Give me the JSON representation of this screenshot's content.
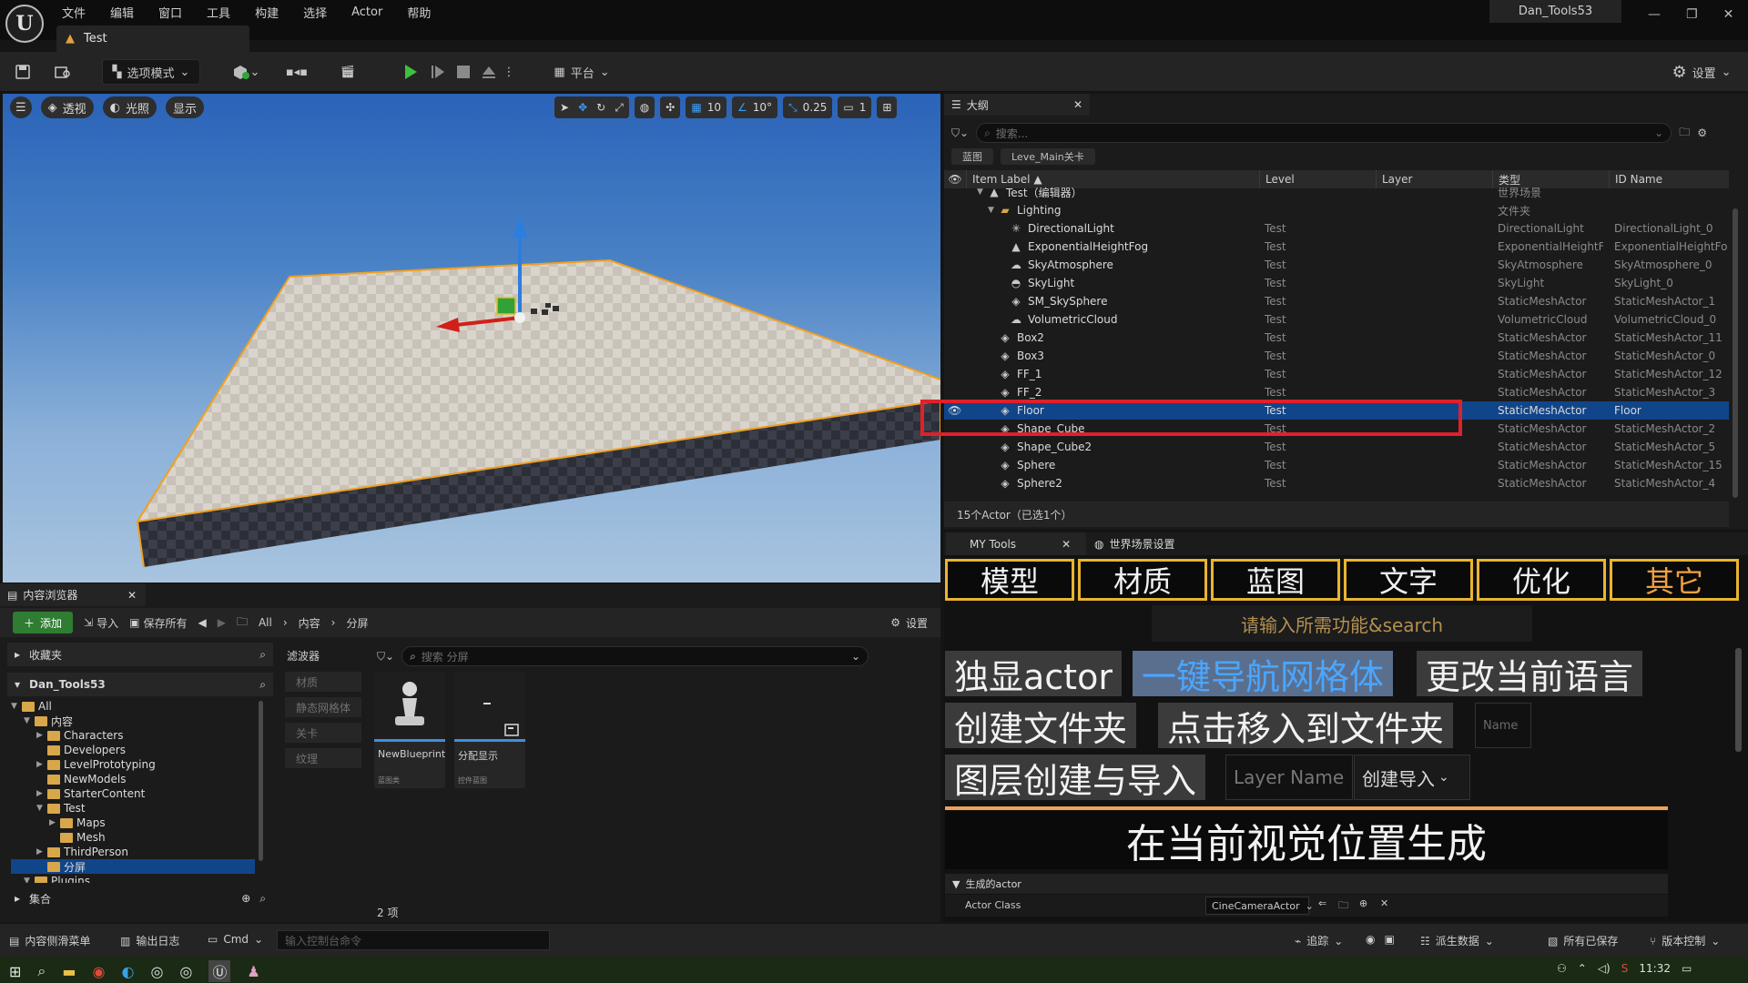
{
  "app": {
    "menu": [
      "文件",
      "编辑",
      "窗口",
      "工具",
      "构建",
      "选择",
      "Actor",
      "帮助"
    ],
    "project_name": "Dan_Tools53",
    "doc_tab": "Test",
    "window_controls": [
      "—",
      "❐",
      "✕"
    ]
  },
  "toolbar": {
    "mode_label": "选项模式",
    "platform_label": "平台",
    "settings_label": "设置"
  },
  "viewport": {
    "perspective": "透视",
    "lighting": "光照",
    "show": "显示",
    "grid_snap": "10",
    "rot_snap": "10°",
    "scale_snap": "0.25",
    "camera_speed": "1"
  },
  "outliner": {
    "tab_title": "大纲",
    "search_placeholder": "搜索...",
    "pills": [
      "蓝图",
      "Leve_Main关卡"
    ],
    "columns": [
      "Item Label ▲",
      "Level",
      "Layer",
      "类型",
      "ID Name"
    ],
    "rows": [
      {
        "label": "Test（编辑器）",
        "level": "",
        "type": "世界场景",
        "id": "",
        "depth": 1,
        "icon": "world-icon",
        "partial": true
      },
      {
        "label": "Lighting",
        "level": "",
        "type": "文件夹",
        "id": "",
        "depth": 2,
        "icon": "folder-icon"
      },
      {
        "label": "DirectionalLight",
        "level": "Test",
        "type": "DirectionalLight",
        "id": "DirectionalLight_0",
        "depth": 3,
        "icon": "sun-icon"
      },
      {
        "label": "ExponentialHeightFog",
        "level": "Test",
        "type": "ExponentialHeightFog",
        "id": "ExponentialHeightFog",
        "depth": 3,
        "icon": "fog-icon"
      },
      {
        "label": "SkyAtmosphere",
        "level": "Test",
        "type": "SkyAtmosphere",
        "id": "SkyAtmosphere_0",
        "depth": 3,
        "icon": "atmosphere-icon"
      },
      {
        "label": "SkyLight",
        "level": "Test",
        "type": "SkyLight",
        "id": "SkyLight_0",
        "depth": 3,
        "icon": "skylight-icon"
      },
      {
        "label": "SM_SkySphere",
        "level": "Test",
        "type": "StaticMeshActor",
        "id": "StaticMeshActor_1",
        "depth": 3,
        "icon": "cube-icon"
      },
      {
        "label": "VolumetricCloud",
        "level": "Test",
        "type": "VolumetricCloud",
        "id": "VolumetricCloud_0",
        "depth": 3,
        "icon": "cloud-icon"
      },
      {
        "label": "Box2",
        "level": "Test",
        "type": "StaticMeshActor",
        "id": "StaticMeshActor_11",
        "depth": 2,
        "icon": "cube-icon"
      },
      {
        "label": "Box3",
        "level": "Test",
        "type": "StaticMeshActor",
        "id": "StaticMeshActor_0",
        "depth": 2,
        "icon": "cube-icon"
      },
      {
        "label": "FF_1",
        "level": "Test",
        "type": "StaticMeshActor",
        "id": "StaticMeshActor_12",
        "depth": 2,
        "icon": "cube-icon"
      },
      {
        "label": "FF_2",
        "level": "Test",
        "type": "StaticMeshActor",
        "id": "StaticMeshActor_3",
        "depth": 2,
        "icon": "cube-icon",
        "partial": true
      },
      {
        "label": "Floor",
        "level": "Test",
        "type": "StaticMeshActor",
        "id": "Floor",
        "depth": 2,
        "icon": "cube-icon",
        "selected": true
      },
      {
        "label": "Shape_Cube",
        "level": "Test",
        "type": "StaticMeshActor",
        "id": "StaticMeshActor_2",
        "depth": 2,
        "icon": "cube-icon",
        "partial": true
      },
      {
        "label": "Shape_Cube2",
        "level": "Test",
        "type": "StaticMeshActor",
        "id": "StaticMeshActor_5",
        "depth": 2,
        "icon": "cube-icon"
      },
      {
        "label": "Sphere",
        "level": "Test",
        "type": "StaticMeshActor",
        "id": "StaticMeshActor_15",
        "depth": 2,
        "icon": "cube-icon"
      },
      {
        "label": "Sphere2",
        "level": "Test",
        "type": "StaticMeshActor",
        "id": "StaticMeshActor_4",
        "depth": 2,
        "icon": "cube-icon"
      }
    ],
    "footer": "15个Actor（已选1个）"
  },
  "mytools": {
    "tab1": "MY Tools",
    "tab2": "世界场景设置",
    "categories": [
      "模型",
      "材质",
      "蓝图",
      "文字",
      "优化",
      "其它"
    ],
    "search_hint": "请输入所需功能&search",
    "btn_solo": "独显actor",
    "btn_navmesh": "一键导航网格体",
    "btn_language": "更改当前语言",
    "btn_create_folder": "创建文件夹",
    "btn_move_folder": "点击移入到文件夹",
    "name_placeholder": "Name",
    "btn_layer": "图层创建与导入",
    "layer_placeholder": "Layer Name",
    "layer_dropdown": "创建导入",
    "btn_spawn": "在当前视觉位置生成",
    "section_title": "生成的actor",
    "actor_class_label": "Actor Class",
    "actor_class_value": "CineCameraActor"
  },
  "content_browser": {
    "tab_title": "内容浏览器",
    "add": "添加",
    "import": "导入",
    "save_all": "保存所有",
    "breadcrumb": [
      "All",
      "内容",
      "分屏"
    ],
    "settings": "设置",
    "favorites": "收藏夹",
    "project": "Dan_Tools53",
    "tree": [
      {
        "label": "All",
        "depth": 0,
        "open": true
      },
      {
        "label": "内容",
        "depth": 1,
        "open": true
      },
      {
        "label": "Characters",
        "depth": 2,
        "open": false
      },
      {
        "label": "Developers",
        "depth": 2,
        "leaf": true
      },
      {
        "label": "LevelPrototyping",
        "depth": 2,
        "open": false
      },
      {
        "label": "NewModels",
        "depth": 2,
        "leaf": true
      },
      {
        "label": "StarterContent",
        "depth": 2,
        "open": false
      },
      {
        "label": "Test",
        "depth": 2,
        "open": true
      },
      {
        "label": "Maps",
        "depth": 3,
        "open": false
      },
      {
        "label": "Mesh",
        "depth": 3,
        "leaf": true
      },
      {
        "label": "ThirdPerson",
        "depth": 2,
        "open": false
      },
      {
        "label": "分屏",
        "depth": 2,
        "leaf": true,
        "selected": true
      },
      {
        "label": "Plugins",
        "depth": 1,
        "open": true
      }
    ],
    "collections": "集合",
    "filters_title": "滤波器",
    "filters": [
      "材质",
      "静态网格体",
      "关卡",
      "纹理"
    ],
    "search_placeholder": "搜索 分屏",
    "assets": [
      {
        "name": "NewBlueprint",
        "type": "蓝图类",
        "color": "#3d8fe0"
      },
      {
        "name": "分配显示",
        "type": "控件蓝图",
        "color": "#3d8fe0"
      }
    ],
    "item_count": "2 项"
  },
  "statusbar": {
    "drawer": "内容侧滑菜单",
    "output_log": "输出日志",
    "cmd": "Cmd",
    "console_placeholder": "输入控制台命令",
    "trace": "追踪",
    "derived_data": "派生数据",
    "saved": "所有已保存",
    "source_control": "版本控制"
  },
  "taskbar": {
    "clock": "11:32"
  }
}
